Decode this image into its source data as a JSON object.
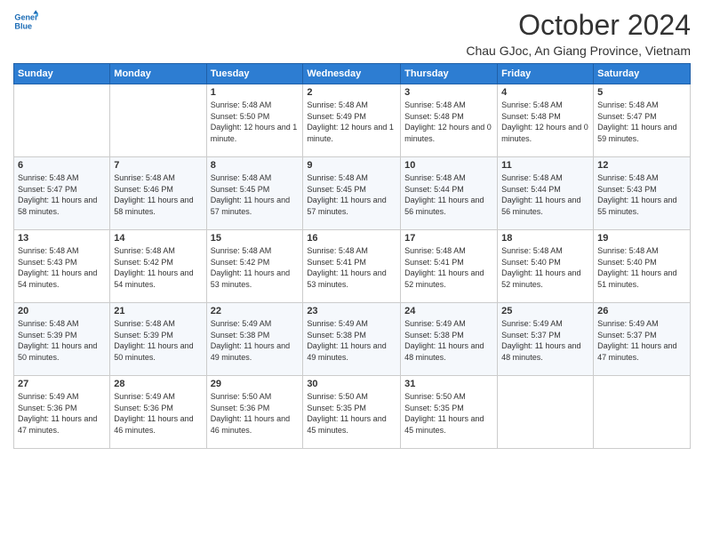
{
  "logo": {
    "line1": "General",
    "line2": "Blue"
  },
  "title": "October 2024",
  "subtitle": "Chau GJoc, An Giang Province, Vietnam",
  "days_of_week": [
    "Sunday",
    "Monday",
    "Tuesday",
    "Wednesday",
    "Thursday",
    "Friday",
    "Saturday"
  ],
  "weeks": [
    [
      {
        "day": "",
        "info": ""
      },
      {
        "day": "",
        "info": ""
      },
      {
        "day": "1",
        "info": "Sunrise: 5:48 AM\nSunset: 5:50 PM\nDaylight: 12 hours and 1 minute."
      },
      {
        "day": "2",
        "info": "Sunrise: 5:48 AM\nSunset: 5:49 PM\nDaylight: 12 hours and 1 minute."
      },
      {
        "day": "3",
        "info": "Sunrise: 5:48 AM\nSunset: 5:48 PM\nDaylight: 12 hours and 0 minutes."
      },
      {
        "day": "4",
        "info": "Sunrise: 5:48 AM\nSunset: 5:48 PM\nDaylight: 12 hours and 0 minutes."
      },
      {
        "day": "5",
        "info": "Sunrise: 5:48 AM\nSunset: 5:47 PM\nDaylight: 11 hours and 59 minutes."
      }
    ],
    [
      {
        "day": "6",
        "info": "Sunrise: 5:48 AM\nSunset: 5:47 PM\nDaylight: 11 hours and 58 minutes."
      },
      {
        "day": "7",
        "info": "Sunrise: 5:48 AM\nSunset: 5:46 PM\nDaylight: 11 hours and 58 minutes."
      },
      {
        "day": "8",
        "info": "Sunrise: 5:48 AM\nSunset: 5:45 PM\nDaylight: 11 hours and 57 minutes."
      },
      {
        "day": "9",
        "info": "Sunrise: 5:48 AM\nSunset: 5:45 PM\nDaylight: 11 hours and 57 minutes."
      },
      {
        "day": "10",
        "info": "Sunrise: 5:48 AM\nSunset: 5:44 PM\nDaylight: 11 hours and 56 minutes."
      },
      {
        "day": "11",
        "info": "Sunrise: 5:48 AM\nSunset: 5:44 PM\nDaylight: 11 hours and 56 minutes."
      },
      {
        "day": "12",
        "info": "Sunrise: 5:48 AM\nSunset: 5:43 PM\nDaylight: 11 hours and 55 minutes."
      }
    ],
    [
      {
        "day": "13",
        "info": "Sunrise: 5:48 AM\nSunset: 5:43 PM\nDaylight: 11 hours and 54 minutes."
      },
      {
        "day": "14",
        "info": "Sunrise: 5:48 AM\nSunset: 5:42 PM\nDaylight: 11 hours and 54 minutes."
      },
      {
        "day": "15",
        "info": "Sunrise: 5:48 AM\nSunset: 5:42 PM\nDaylight: 11 hours and 53 minutes."
      },
      {
        "day": "16",
        "info": "Sunrise: 5:48 AM\nSunset: 5:41 PM\nDaylight: 11 hours and 53 minutes."
      },
      {
        "day": "17",
        "info": "Sunrise: 5:48 AM\nSunset: 5:41 PM\nDaylight: 11 hours and 52 minutes."
      },
      {
        "day": "18",
        "info": "Sunrise: 5:48 AM\nSunset: 5:40 PM\nDaylight: 11 hours and 52 minutes."
      },
      {
        "day": "19",
        "info": "Sunrise: 5:48 AM\nSunset: 5:40 PM\nDaylight: 11 hours and 51 minutes."
      }
    ],
    [
      {
        "day": "20",
        "info": "Sunrise: 5:48 AM\nSunset: 5:39 PM\nDaylight: 11 hours and 50 minutes."
      },
      {
        "day": "21",
        "info": "Sunrise: 5:48 AM\nSunset: 5:39 PM\nDaylight: 11 hours and 50 minutes."
      },
      {
        "day": "22",
        "info": "Sunrise: 5:49 AM\nSunset: 5:38 PM\nDaylight: 11 hours and 49 minutes."
      },
      {
        "day": "23",
        "info": "Sunrise: 5:49 AM\nSunset: 5:38 PM\nDaylight: 11 hours and 49 minutes."
      },
      {
        "day": "24",
        "info": "Sunrise: 5:49 AM\nSunset: 5:38 PM\nDaylight: 11 hours and 48 minutes."
      },
      {
        "day": "25",
        "info": "Sunrise: 5:49 AM\nSunset: 5:37 PM\nDaylight: 11 hours and 48 minutes."
      },
      {
        "day": "26",
        "info": "Sunrise: 5:49 AM\nSunset: 5:37 PM\nDaylight: 11 hours and 47 minutes."
      }
    ],
    [
      {
        "day": "27",
        "info": "Sunrise: 5:49 AM\nSunset: 5:36 PM\nDaylight: 11 hours and 47 minutes."
      },
      {
        "day": "28",
        "info": "Sunrise: 5:49 AM\nSunset: 5:36 PM\nDaylight: 11 hours and 46 minutes."
      },
      {
        "day": "29",
        "info": "Sunrise: 5:50 AM\nSunset: 5:36 PM\nDaylight: 11 hours and 46 minutes."
      },
      {
        "day": "30",
        "info": "Sunrise: 5:50 AM\nSunset: 5:35 PM\nDaylight: 11 hours and 45 minutes."
      },
      {
        "day": "31",
        "info": "Sunrise: 5:50 AM\nSunset: 5:35 PM\nDaylight: 11 hours and 45 minutes."
      },
      {
        "day": "",
        "info": ""
      },
      {
        "day": "",
        "info": ""
      }
    ]
  ]
}
